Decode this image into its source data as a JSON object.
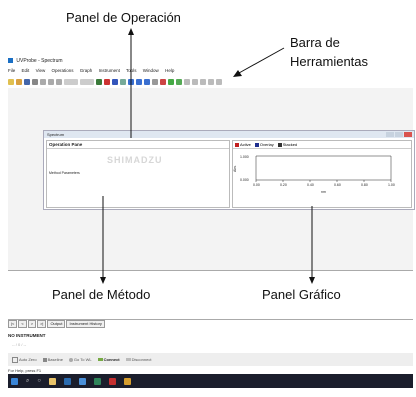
{
  "annotations": {
    "top": "Panel de Operación",
    "toolbar_line1": "Barra de",
    "toolbar_line2": "Herramientas",
    "method": "Panel de Método",
    "graph": "Panel Gráfico"
  },
  "app": {
    "title": "UVProbe - Spectrum"
  },
  "menu": [
    "File",
    "Edit",
    "View",
    "Operations",
    "Graph",
    "Instrument",
    "Tools",
    "Window",
    "Help"
  ],
  "spectrum_window": {
    "title": "Spectrum",
    "operation_header": "Operation Pane",
    "logo": "SHIMADZU",
    "method_label": "Method Parameters",
    "graph_tabs": [
      "Active",
      "Overlay",
      "Stacked"
    ]
  },
  "graph": {
    "y_ticks": [
      "1.000",
      "0.000"
    ],
    "x_ticks": [
      "0.00",
      "0.20",
      "0.40",
      "0.60",
      "0.80",
      "1.00"
    ],
    "x_unit": "nm",
    "y_unit": "Abs."
  },
  "bottom_tabs": [
    "Output",
    "Instrument History"
  ],
  "status": {
    "instrument": "NO INSTRUMENT",
    "sub": "-- / 0 / --"
  },
  "buttons": [
    "Auto Zero",
    "Baseline",
    "Go To WL",
    "Connect",
    "Disconnect"
  ],
  "help_text": "For Help, press F1",
  "colors": {
    "taskbar": "#1b1e2c",
    "workspace": "#f3f3f3",
    "accent": "#1a6fc4",
    "active_tab": "#c21f1f",
    "overlay_tab": "#1f2f8f"
  }
}
